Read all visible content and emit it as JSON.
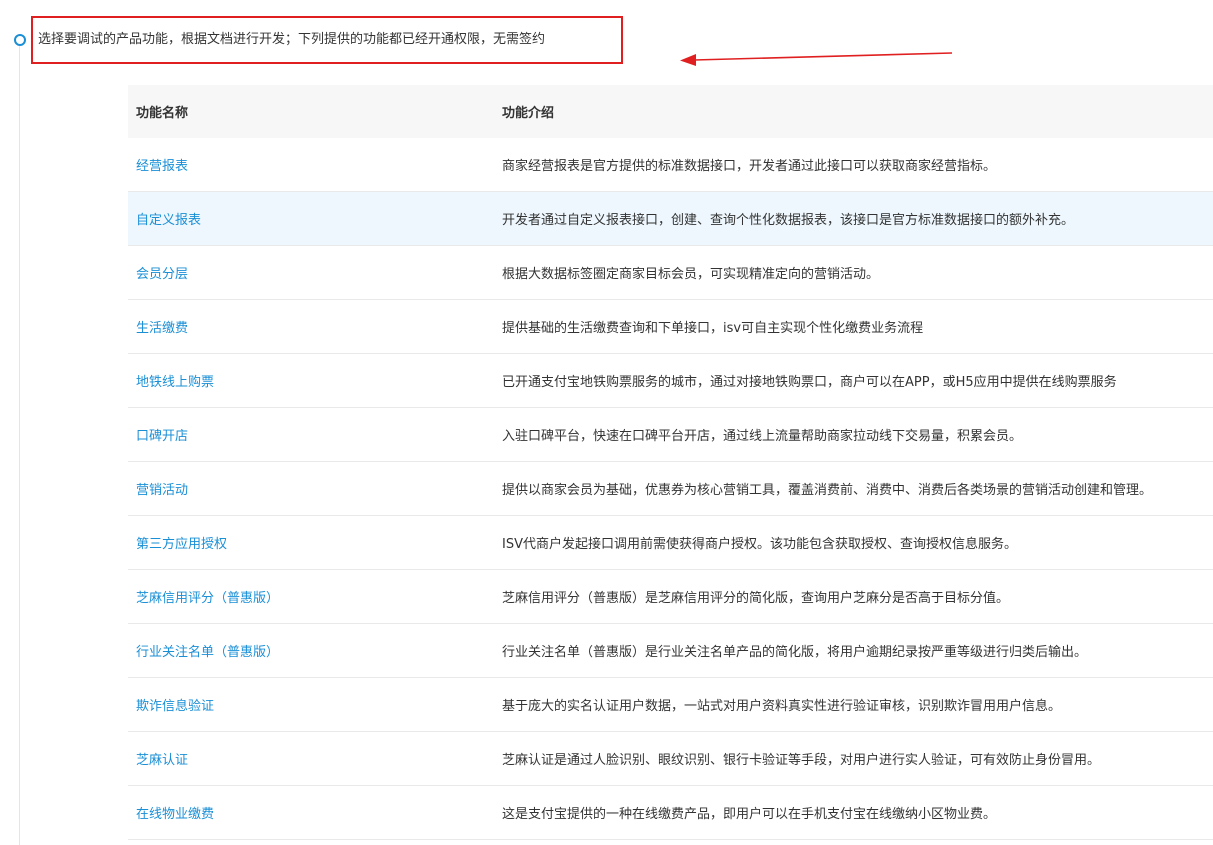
{
  "step": {
    "text": "选择要调试的产品功能，根据文档进行开发；下列提供的功能都已经开通权限，无需签约"
  },
  "table": {
    "headers": {
      "name": "功能名称",
      "desc": "功能介绍"
    },
    "rows": [
      {
        "name": "经营报表",
        "desc": "商家经营报表是官方提供的标准数据接口，开发者通过此接口可以获取商家经营指标。"
      },
      {
        "name": "自定义报表",
        "desc": "开发者通过自定义报表接口，创建、查询个性化数据报表，该接口是官方标准数据接口的额外补充。"
      },
      {
        "name": "会员分层",
        "desc": "根据大数据标签圈定商家目标会员，可实现精准定向的营销活动。"
      },
      {
        "name": "生活缴费",
        "desc": "提供基础的生活缴费查询和下单接口，isv可自主实现个性化缴费业务流程"
      },
      {
        "name": "地铁线上购票",
        "desc": "已开通支付宝地铁购票服务的城市，通过对接地铁购票口，商户可以在APP，或H5应用中提供在线购票服务"
      },
      {
        "name": "口碑开店",
        "desc": "入驻口碑平台，快速在口碑平台开店，通过线上流量帮助商家拉动线下交易量，积累会员。"
      },
      {
        "name": "营销活动",
        "desc": "提供以商家会员为基础，优惠券为核心营销工具，覆盖消费前、消费中、消费后各类场景的营销活动创建和管理。"
      },
      {
        "name": "第三方应用授权",
        "desc": "ISV代商户发起接口调用前需使获得商户授权。该功能包含获取授权、查询授权信息服务。"
      },
      {
        "name": "芝麻信用评分（普惠版）",
        "desc": "芝麻信用评分（普惠版）是芝麻信用评分的简化版，查询用户芝麻分是否高于目标分值。"
      },
      {
        "name": "行业关注名单（普惠版）",
        "desc": "行业关注名单（普惠版）是行业关注名单产品的简化版，将用户逾期纪录按严重等级进行归类后输出。"
      },
      {
        "name": "欺诈信息验证",
        "desc": "基于庞大的实名认证用户数据，一站式对用户资料真实性进行验证审核，识别欺诈冒用用户信息。"
      },
      {
        "name": "芝麻认证",
        "desc": "芝麻认证是通过人脸识别、眼纹识别、银行卡验证等手段，对用户进行实人验证，可有效防止身份冒用。"
      },
      {
        "name": "在线物业缴费",
        "desc": "这是支付宝提供的一种在线缴费产品，即用户可以在手机支付宝在线缴纳小区物业费。"
      }
    ]
  },
  "colors": {
    "link": "#1a8fd6",
    "highlight_border": "#e02020",
    "row_highlight": "#edf7fd"
  }
}
